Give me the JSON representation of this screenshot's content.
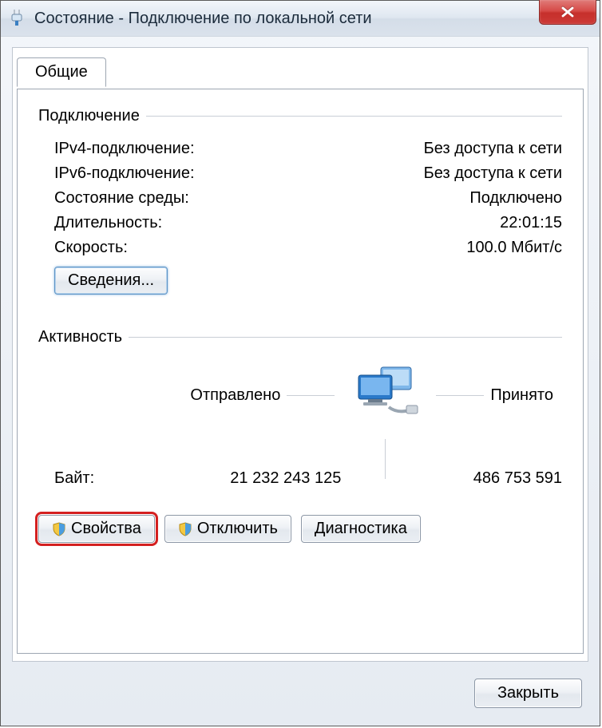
{
  "window": {
    "title": "Состояние - Подключение по локальной сети"
  },
  "tabs": {
    "general": "Общие"
  },
  "group_connection": {
    "title": "Подключение",
    "rows": {
      "ipv4": {
        "label": "IPv4-подключение:",
        "value": "Без доступа к сети"
      },
      "ipv6": {
        "label": "IPv6-подключение:",
        "value": "Без доступа к сети"
      },
      "media": {
        "label": "Состояние среды:",
        "value": "Подключено"
      },
      "duration": {
        "label": "Длительность:",
        "value": "22:01:15"
      },
      "speed": {
        "label": "Скорость:",
        "value": "100.0 Мбит/с"
      }
    },
    "details_button": "Сведения..."
  },
  "group_activity": {
    "title": "Активность",
    "sent_label": "Отправлено",
    "received_label": "Принято",
    "bytes_label": "Байт:",
    "sent_bytes": "21 232 243 125",
    "received_bytes": "486 753 591"
  },
  "buttons": {
    "properties": "Свойства",
    "disable": "Отключить",
    "diagnose": "Диагностика",
    "close": "Закрыть"
  }
}
